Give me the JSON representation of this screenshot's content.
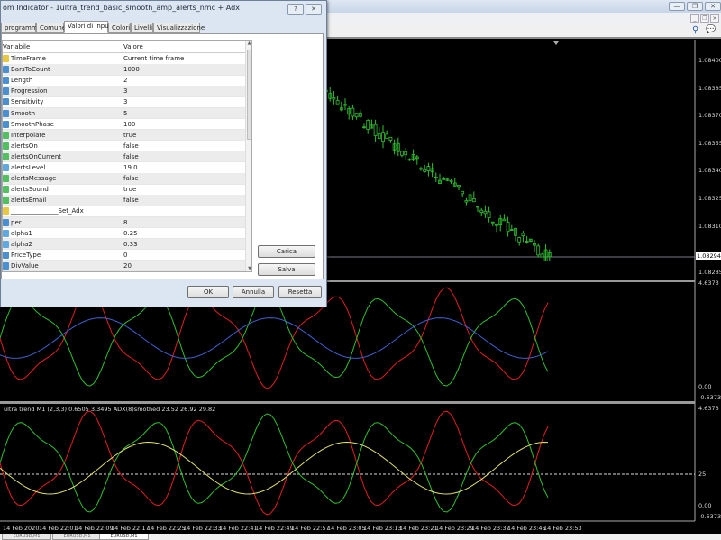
{
  "window": {
    "minimize": "—",
    "restore": "❐",
    "close": "✕"
  },
  "mdi": {
    "minimize": "_",
    "restore": "❐",
    "close": "×"
  },
  "toolbar": {
    "search_icon": "search-icon",
    "chat_icon": "chat-icon"
  },
  "colors": {
    "bear": "#e02020",
    "bull": "#30c030",
    "ema": "#4060d0",
    "adx": "#e0e070",
    "candle": "#30c030"
  },
  "price_axis": {
    "labels": [
      "1.08400",
      "1.08385",
      "1.08370",
      "1.08355",
      "1.08340",
      "1.08325",
      "1.08310",
      "1.08285"
    ],
    "current": "1.08294"
  },
  "ind1_axis": {
    "top": "4.6373",
    "zero": "0.00",
    "bottom": "-0.6373"
  },
  "ind2_axis": {
    "top": "4.6373",
    "level": "25",
    "zero": "0.00",
    "bottom": "-0.6373"
  },
  "ind2_label": "ultra trend M1 (2,3,3) 0.6505 3.3495   ADX(8)smothed 23.52 26.92 29.82",
  "time_axis": [
    "14 Feb 2020",
    "14 Feb 22:01",
    "14 Feb 22:09",
    "14 Feb 22:17",
    "14 Feb 22:25",
    "14 Feb 22:33",
    "14 Feb 22:41",
    "14 Feb 22:49",
    "14 Feb 22:57",
    "14 Feb 23:05",
    "14 Feb 23:13",
    "14 Feb 23:21",
    "14 Feb 23:29",
    "14 Feb 23:37",
    "14 Feb 23:45",
    "14 Feb 23:53"
  ],
  "bottom_tabs": [
    "EURUSD,M1",
    "EURUSD,M1",
    "EURUSD,M1"
  ],
  "dialog": {
    "title": "om Indicator - 1ultra_trend_basic_smooth_amp_alerts_nmc + Adx",
    "help": "?",
    "close": "✕",
    "tabs": [
      "programma",
      "Comune",
      "Valori di input",
      "Colori",
      "Livelli",
      "Visualizzazione"
    ],
    "active_tab": 2,
    "columns": [
      "Variabile",
      "Valore"
    ],
    "rows": [
      {
        "name": "TimeFrame",
        "value": "Current time frame",
        "icon": "enum"
      },
      {
        "name": "BarsToCount",
        "value": "1000",
        "icon": "int"
      },
      {
        "name": "Length",
        "value": "2",
        "icon": "int"
      },
      {
        "name": "Progression",
        "value": "3",
        "icon": "int"
      },
      {
        "name": "Sensitivity",
        "value": "3",
        "icon": "int"
      },
      {
        "name": "Smooth",
        "value": "5",
        "icon": "int"
      },
      {
        "name": "SmoothPhase",
        "value": "100",
        "icon": "int"
      },
      {
        "name": "Interpolate",
        "value": "true",
        "icon": "bool"
      },
      {
        "name": "alertsOn",
        "value": "false",
        "icon": "bool"
      },
      {
        "name": "alertsOnCurrent",
        "value": "false",
        "icon": "bool"
      },
      {
        "name": "alertsLevel",
        "value": "19.0",
        "icon": "double"
      },
      {
        "name": "alertsMessage",
        "value": "false",
        "icon": "bool"
      },
      {
        "name": "alertsSound",
        "value": "true",
        "icon": "bool"
      },
      {
        "name": "alertsEmail",
        "value": "false",
        "icon": "bool"
      },
      {
        "name": "_______________Set_Adx",
        "value": "",
        "icon": "enum"
      },
      {
        "name": "per",
        "value": "8",
        "icon": "int"
      },
      {
        "name": "alpha1",
        "value": "0.25",
        "icon": "double"
      },
      {
        "name": "alpha2",
        "value": "0.33",
        "icon": "double"
      },
      {
        "name": "PriceType",
        "value": "0",
        "icon": "int"
      },
      {
        "name": "DivValue",
        "value": "20",
        "icon": "int"
      }
    ],
    "load_button": "Carica",
    "save_button": "Salva",
    "ok_button": "OK",
    "cancel_button": "Annulla",
    "reset_button": "Resetta"
  }
}
